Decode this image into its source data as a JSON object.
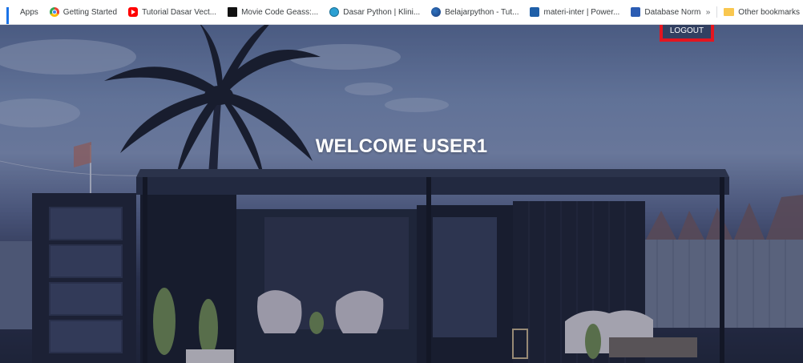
{
  "bookmarks": {
    "items": [
      {
        "label": "Apps",
        "icon": "apps-grid-icon"
      },
      {
        "label": "Getting Started",
        "icon": "chrome-icon"
      },
      {
        "label": "Tutorial Dasar Vect...",
        "icon": "youtube-icon"
      },
      {
        "label": "Movie Code Geass:...",
        "icon": "imdb-icon"
      },
      {
        "label": "Dasar Python | Klini...",
        "icon": "wordpress-icon"
      },
      {
        "label": "Belajarpython - Tut...",
        "icon": "python-icon"
      },
      {
        "label": "materi-inter | Power...",
        "icon": "powerpoint-icon"
      },
      {
        "label": "Database Normaliz...",
        "icon": "word-icon"
      }
    ],
    "overflow_label": "»",
    "other_bookmarks": "Other bookmarks"
  },
  "page": {
    "welcome_text": "WELCOME USER1",
    "logout_label": "LOGOUT"
  },
  "colors": {
    "highlight_border": "#e4151f",
    "welcome_text": "#ffffff",
    "overlay": "#2c3350"
  }
}
